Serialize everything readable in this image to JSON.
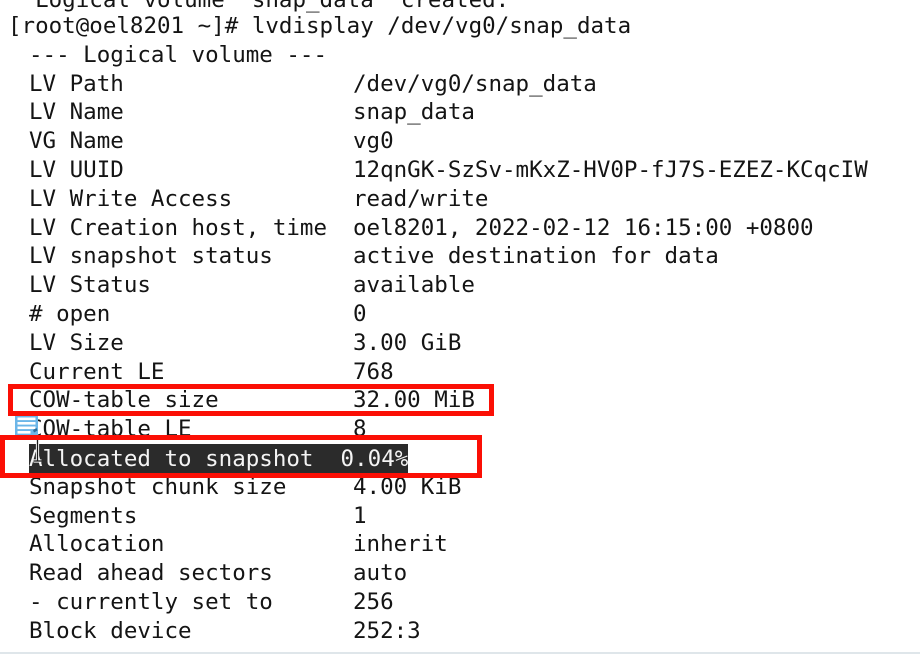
{
  "terminal": {
    "scrollback_line": "  Logical volume \"snap_data\" created.",
    "prompt_line": "[root@oel8201 ~]# lvdisplay /dev/vg0/snap_data",
    "section_header": "--- Logical volume ---",
    "rows": [
      {
        "label": "LV Path",
        "value": "/dev/vg0/snap_data"
      },
      {
        "label": "LV Name",
        "value": "snap_data"
      },
      {
        "label": "VG Name",
        "value": "vg0"
      },
      {
        "label": "LV UUID",
        "value": "12qnGK-SzSv-mKxZ-HV0P-fJ7S-EZEZ-KCqcIW"
      },
      {
        "label": "LV Write Access",
        "value": "read/write"
      },
      {
        "label": "LV Creation host, time",
        "value": "oel8201, 2022-02-12 16:15:00 +0800"
      },
      {
        "label": "LV snapshot status",
        "value": "active destination for data"
      },
      {
        "label": "LV Status",
        "value": "available"
      },
      {
        "label": "# open",
        "value": "0"
      },
      {
        "label": "LV Size",
        "value": "3.00 GiB"
      },
      {
        "label": "Current LE",
        "value": "768"
      },
      {
        "label": "COW-table size",
        "value": "32.00 MiB"
      },
      {
        "label": "COW-table LE",
        "value": "8"
      },
      {
        "label": "Allocated to snapshot",
        "value": "0.04%"
      },
      {
        "label": "Snapshot chunk size",
        "value": "4.00 KiB"
      },
      {
        "label": "Segments",
        "value": "1"
      },
      {
        "label": "Allocation",
        "value": "inherit"
      },
      {
        "label": "Read ahead sectors",
        "value": "auto"
      },
      {
        "label": "- currently set to",
        "value": "256"
      },
      {
        "label": "Block device",
        "value": "252:3"
      }
    ],
    "selection": {
      "text": "Allocated to snapshot  0.04%",
      "background_color": "#2b2b2b",
      "foreground_color": "#f4f4f4"
    }
  },
  "annotations": {
    "highlight_color": "#fb0f05",
    "boxes": [
      {
        "name": "cow-table-size-highlight",
        "target_label": "COW-table size",
        "target_value": "32.00 MiB"
      },
      {
        "name": "allocated-to-snapshot-highlight",
        "target_label": "Allocated to snapshot",
        "target_value": "0.04%"
      }
    ]
  },
  "icons": {
    "document_icon": "document-lines-icon",
    "cursor_icon": "text-ibeam-cursor"
  },
  "colors": {
    "terminal_background": "#ffffff",
    "terminal_foreground": "#141414",
    "annotation_red": "#fb0f05",
    "icon_blue": "#4a9fdc"
  }
}
